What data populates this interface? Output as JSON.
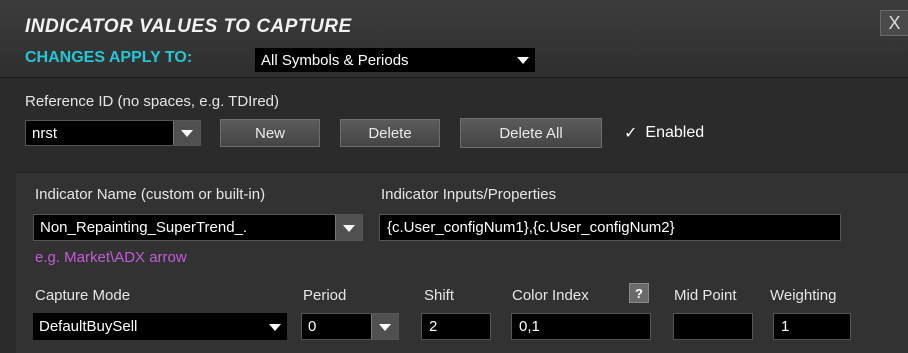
{
  "header": {
    "title": "INDICATOR VALUES TO CAPTURE",
    "close_label": "X",
    "apply_label": "CHANGES APPLY TO:",
    "apply_value": "All Symbols & Periods"
  },
  "reference": {
    "label": "Reference ID (no spaces, e.g. TDIred)",
    "value": "nrst",
    "new_label": "New",
    "delete_label": "Delete",
    "delete_all_label": "Delete All",
    "enabled_label": "Enabled",
    "enabled_mark": "✓"
  },
  "indicator": {
    "name_label": "Indicator Name (custom or built-in)",
    "name_value": "Non_Repainting_SuperTrend_.",
    "name_hint": "e.g. Market\\ADX arrow",
    "inputs_label": "Indicator Inputs/Properties",
    "inputs_value": "{c.User_configNum1},{c.User_configNum2}"
  },
  "capture": {
    "mode_label": "Capture Mode",
    "mode_value": "DefaultBuySell",
    "period_label": "Period",
    "period_value": "0",
    "shift_label": "Shift",
    "shift_value": "2",
    "color_index_label": "Color Index",
    "color_index_help": "?",
    "color_index_value": "0,1",
    "mid_point_label": "Mid Point",
    "mid_point_value": "",
    "weighting_label": "Weighting",
    "weighting_value": "1"
  },
  "colors": {
    "accent": "#23c7d6",
    "hint": "#c25bd8",
    "background": "#2b2b2b"
  }
}
